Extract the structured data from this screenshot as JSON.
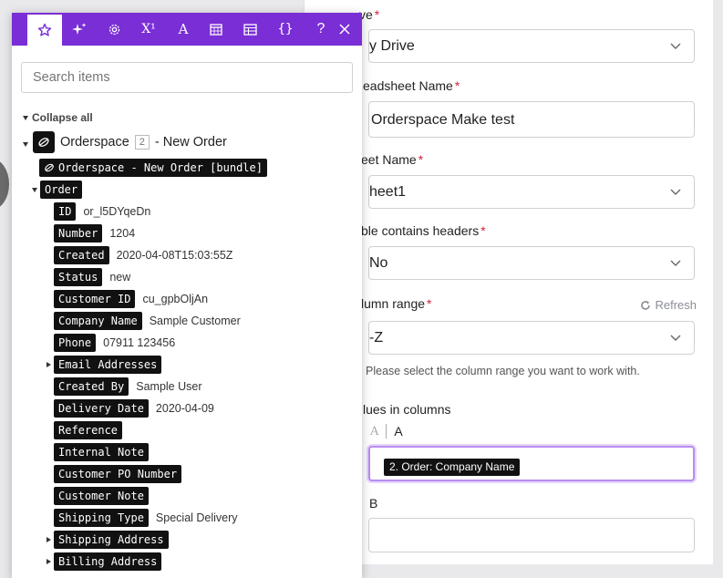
{
  "form": {
    "fields": [
      {
        "label": "ve",
        "value": "y Drive",
        "type": "select"
      },
      {
        "label": "eadsheet Name",
        "value": "Orderspace Make test",
        "type": "text"
      },
      {
        "label": "eet Name",
        "value": "heet1",
        "type": "select"
      },
      {
        "label": "ble contains headers",
        "value": "No",
        "type": "select"
      },
      {
        "label": "lumn range",
        "value": "-Z",
        "type": "select"
      }
    ],
    "refresh_label": "Refresh",
    "range_hint": "Please select the column range you want to work with.",
    "values_label": "lues in columns",
    "column_a_label": "A",
    "column_a_pill": "2. Order: Company Name",
    "column_b_label": "B"
  },
  "panel": {
    "tabs": [
      {
        "icon": "star-icon"
      },
      {
        "icon": "sparkle-icon"
      },
      {
        "icon": "gear-icon"
      },
      {
        "icon": "superscript-icon",
        "text": "X¹"
      },
      {
        "icon": "text-icon",
        "text": "A"
      },
      {
        "icon": "calendar-icon"
      },
      {
        "icon": "table-icon"
      },
      {
        "icon": "braces-icon",
        "text": "{}"
      },
      {
        "icon": "help-icon",
        "text": "?"
      },
      {
        "icon": "close-icon"
      }
    ],
    "search_placeholder": "Search items",
    "collapse_all": "Collapse all",
    "module": {
      "name": "Orderspace",
      "badge": "2",
      "suffix": "- New Order"
    },
    "bundle_tag": "Orderspace - New Order [bundle]",
    "order_tag": "Order",
    "items": [
      {
        "key": "ID",
        "value": "or_l5DYqeDn",
        "expandable": false
      },
      {
        "key": "Number",
        "value": "1204",
        "expandable": false
      },
      {
        "key": "Created",
        "value": "2020-04-08T15:03:55Z",
        "expandable": false
      },
      {
        "key": "Status",
        "value": "new",
        "expandable": false
      },
      {
        "key": "Customer ID",
        "value": "cu_gpbOljAn",
        "expandable": false
      },
      {
        "key": "Company Name",
        "value": "Sample Customer",
        "expandable": false
      },
      {
        "key": "Phone",
        "value": "07911 123456",
        "expandable": false
      },
      {
        "key": "Email Addresses",
        "value": "",
        "expandable": true
      },
      {
        "key": "Created By",
        "value": "Sample User",
        "expandable": false
      },
      {
        "key": "Delivery Date",
        "value": "2020-04-09",
        "expandable": false
      },
      {
        "key": "Reference",
        "value": "",
        "expandable": false
      },
      {
        "key": "Internal Note",
        "value": "",
        "expandable": false
      },
      {
        "key": "Customer PO Number",
        "value": "",
        "expandable": false
      },
      {
        "key": "Customer Note",
        "value": "",
        "expandable": false
      },
      {
        "key": "Shipping Type",
        "value": "Special Delivery",
        "expandable": false
      },
      {
        "key": "Shipping Address",
        "value": "",
        "expandable": true
      },
      {
        "key": "Billing Address",
        "value": "",
        "expandable": true
      }
    ]
  },
  "colors": {
    "accent": "#7a2ed6",
    "required": "#d1223c"
  }
}
